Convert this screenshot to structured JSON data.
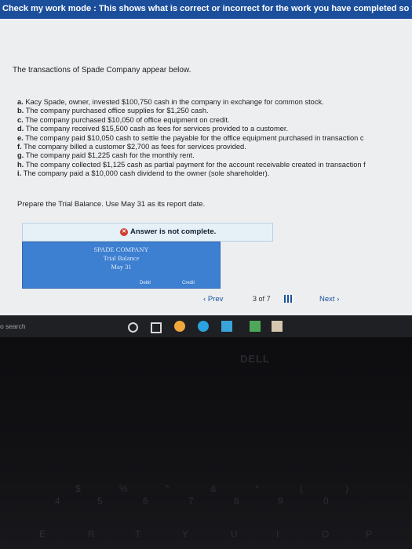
{
  "banner": {
    "text": "Check my work mode : This shows what is correct or incorrect for the work you have completed so far. It"
  },
  "problem": {
    "intro": "The transactions of Spade Company appear below.",
    "transactions": [
      {
        "letter": "a.",
        "text": "Kacy Spade, owner, invested $100,750 cash in the company in exchange for common stock."
      },
      {
        "letter": "b.",
        "text": "The company purchased office supplies for $1,250 cash."
      },
      {
        "letter": "c.",
        "text": "The company purchased $10,050 of office equipment on credit."
      },
      {
        "letter": "d.",
        "text": "The company received $15,500 cash as fees for services provided to a customer."
      },
      {
        "letter": "e.",
        "text": "The company paid $10,050 cash to settle the payable for the office equipment purchased in transaction c"
      },
      {
        "letter": "f.",
        "text": "The company billed a customer $2,700 as fees for services provided."
      },
      {
        "letter": "g.",
        "text": "The company paid $1,225 cash for the monthly rent."
      },
      {
        "letter": "h.",
        "text": "The company collected $1,125 cash as partial payment for the account receivable created in transaction f"
      },
      {
        "letter": "i.",
        "text": "The company paid a $10,000 cash dividend to the owner (sole shareholder)."
      }
    ],
    "prompt": "Prepare the Trial Balance. Use May 31 as its report date."
  },
  "answer": {
    "status": "Answer is not complete.",
    "status_icon": "x-circle-icon",
    "status_color": "#d23b2e"
  },
  "trial_balance": {
    "company": "SPADE COMPANY",
    "title": "Trial Balance",
    "date": "May 31",
    "col_debit": "Debit",
    "col_credit": "Credit"
  },
  "nav": {
    "prev": "Prev",
    "current": "3",
    "of": "of",
    "total": "7",
    "next": "Next"
  },
  "taskbar": {
    "search": "o search"
  },
  "laptop": {
    "brand": "DELL",
    "keys_row1": [
      "$",
      "%",
      "^",
      "&",
      "*",
      "(",
      ")"
    ],
    "keys_row2": [
      "4",
      "5",
      "6",
      "7",
      "8",
      "9",
      "0"
    ],
    "keys_row3": [
      "E",
      "R",
      "T",
      "Y",
      "U",
      "I",
      "O",
      "P"
    ]
  },
  "colors": {
    "accent": "#1b4f9c",
    "table_header": "#3d7fd0"
  }
}
